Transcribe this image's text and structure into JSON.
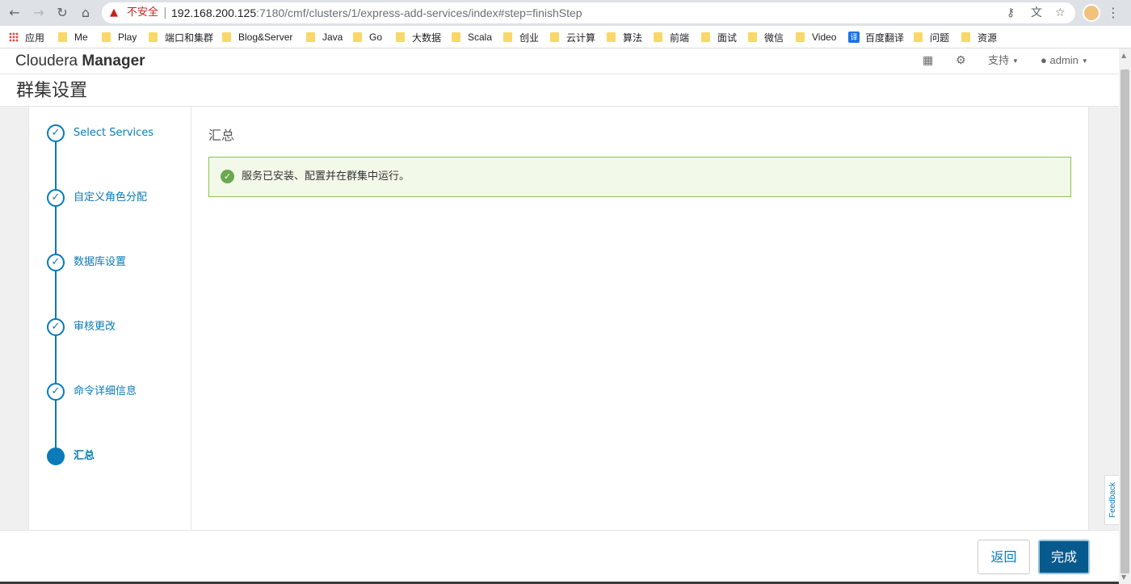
{
  "browser": {
    "back_icon": "arrow-left-icon",
    "forward_icon": "arrow-right-icon",
    "reload_icon": "reload-icon",
    "home_icon": "home-icon",
    "insecure_label": "不安全",
    "url_host": "192.168.200.125",
    "url_path": ":7180/cmf/clusters/1/express-add-services/index#step=finishStep",
    "bookmarks": [
      "应用",
      "Me",
      "Play",
      "端口和集群",
      "Blog&Server",
      "Java",
      "Go",
      "大数据",
      "Scala",
      "创业",
      "云计算",
      "算法",
      "前端",
      "面试",
      "微信",
      "Video",
      "百度翻译",
      "问题",
      "资源"
    ]
  },
  "header": {
    "brand_light": "Cloudera",
    "brand_bold": "Manager",
    "support_label": "支持",
    "user_label": "admin"
  },
  "page": {
    "title": "群集设置"
  },
  "steps": [
    {
      "label": "Select Services",
      "status": "done"
    },
    {
      "label": "自定义角色分配",
      "status": "done"
    },
    {
      "label": "数据库设置",
      "status": "done"
    },
    {
      "label": "审核更改",
      "status": "done"
    },
    {
      "label": "命令详细信息",
      "status": "done"
    },
    {
      "label": "汇总",
      "status": "active"
    }
  ],
  "content": {
    "section_title": "汇总",
    "alert_text": "服务已安装、配置并在群集中运行。"
  },
  "footer": {
    "back_label": "返回",
    "finish_label": "完成"
  },
  "feedback_label": "Feedback",
  "colors": {
    "accent": "#0a7ab8",
    "primary_button": "#075a8e",
    "success_border": "#8cc152",
    "success_bg": "#f3f9e9"
  }
}
